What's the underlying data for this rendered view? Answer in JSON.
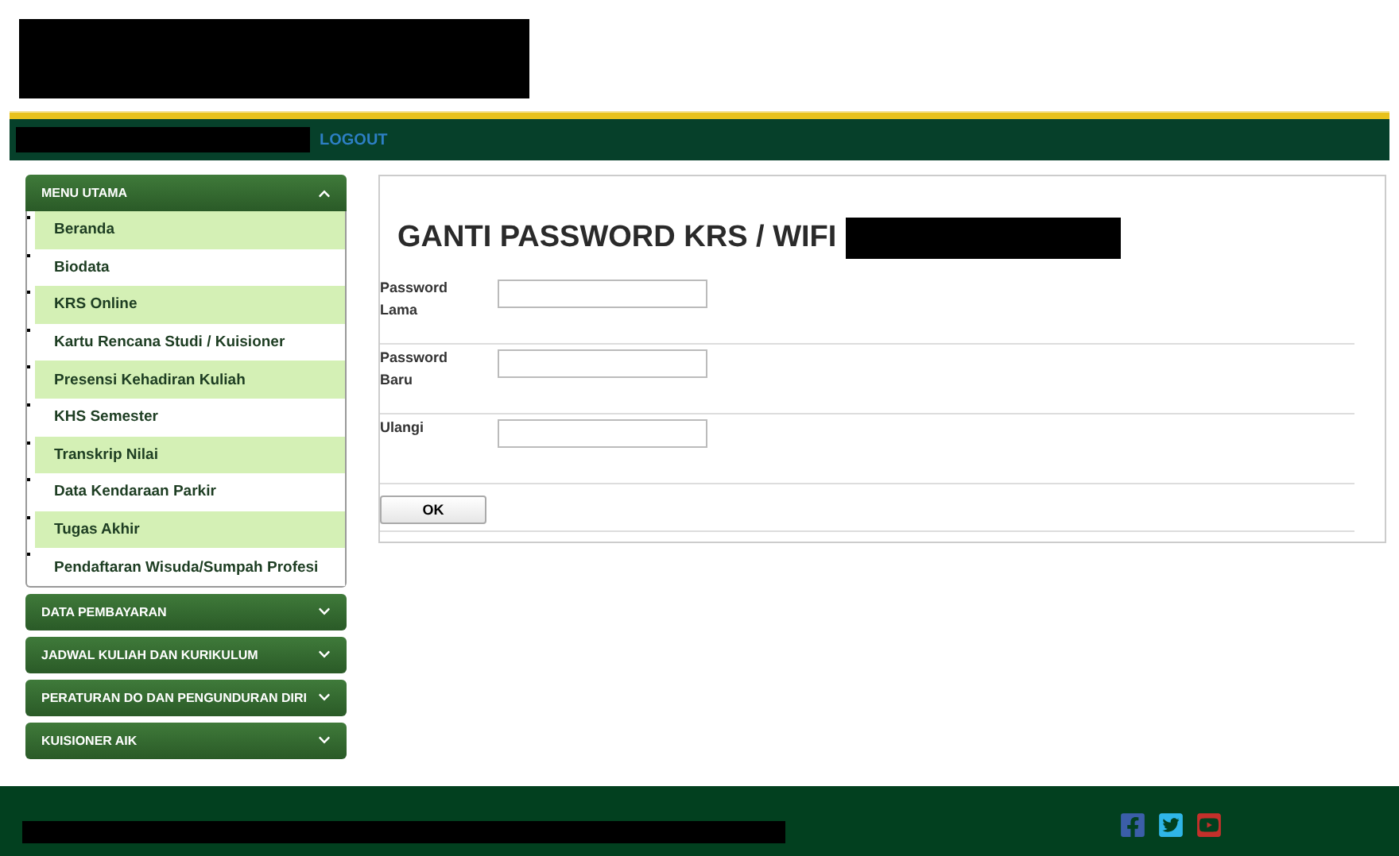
{
  "nav": {
    "logout": "LOGOUT"
  },
  "sidebar": {
    "sections": [
      {
        "title": "MENU UTAMA",
        "expanded": true,
        "items": [
          "Beranda",
          "Biodata",
          "KRS Online",
          "Kartu Rencana Studi / Kuisioner",
          "Presensi Kehadiran Kuliah",
          "KHS Semester",
          "Transkrip Nilai",
          "Data Kendaraan Parkir",
          "Tugas Akhir",
          "Pendaftaran Wisuda/Sumpah Profesi"
        ]
      },
      {
        "title": "DATA PEMBAYARAN",
        "expanded": false
      },
      {
        "title": "JADWAL KULIAH DAN KURIKULUM",
        "expanded": false
      },
      {
        "title": "PERATURAN DO DAN PENGUNDURAN DIRI",
        "expanded": false
      },
      {
        "title": "KUISIONER AIK",
        "expanded": false
      }
    ]
  },
  "form": {
    "title": "GANTI PASSWORD KRS / WIFI",
    "fields": [
      {
        "label": "Password Lama"
      },
      {
        "label": "Password Baru"
      },
      {
        "label": "Ulangi"
      }
    ],
    "submit": "OK"
  }
}
